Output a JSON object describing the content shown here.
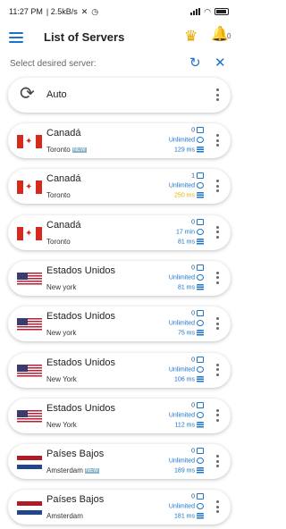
{
  "status": {
    "time": "11:27 PM",
    "speed": "2.5kB/s"
  },
  "appbar": {
    "title": "List of Servers",
    "notification_count": "0"
  },
  "select_label": "Select desired server:",
  "auto": {
    "label": "Auto"
  },
  "servers": [
    {
      "country": "Canadá",
      "city": "Toronto",
      "new": true,
      "flag": "ca",
      "users": "0",
      "time": "Unlimited",
      "ping": "129 ms",
      "ping_color": "blue"
    },
    {
      "country": "Canadá",
      "city": "Toronto",
      "new": false,
      "flag": "ca",
      "users": "1",
      "time": "Unlimited",
      "ping": "250 ms",
      "ping_color": "yellow"
    },
    {
      "country": "Canadá",
      "city": "Toronto",
      "new": false,
      "flag": "ca",
      "users": "0",
      "time": "17 min",
      "ping": "81 ms",
      "ping_color": "blue"
    },
    {
      "country": "Estados Unidos",
      "city": "New york",
      "new": false,
      "flag": "us",
      "users": "0",
      "time": "Unlimited",
      "ping": "81 ms",
      "ping_color": "blue"
    },
    {
      "country": "Estados Unidos",
      "city": "New york",
      "new": false,
      "flag": "us",
      "users": "0",
      "time": "Unlimited",
      "ping": "75 ms",
      "ping_color": "blue"
    },
    {
      "country": "Estados Unidos",
      "city": "New York",
      "new": false,
      "flag": "us",
      "users": "0",
      "time": "Unlimited",
      "ping": "106 ms",
      "ping_color": "blue"
    },
    {
      "country": "Estados Unidos",
      "city": "New York",
      "new": false,
      "flag": "us",
      "users": "0",
      "time": "Unlimited",
      "ping": "112 ms",
      "ping_color": "blue"
    },
    {
      "country": "Países Bajos",
      "city": "Amsterdam",
      "new": true,
      "flag": "nl",
      "users": "0",
      "time": "Unlimited",
      "ping": "189 ms",
      "ping_color": "blue"
    },
    {
      "country": "Países Bajos",
      "city": "Amsterdam",
      "new": false,
      "flag": "nl",
      "users": "0",
      "time": "Unlimited",
      "ping": "181 ms",
      "ping_color": "blue"
    }
  ],
  "new_badge_label": "NEW",
  "colors": {
    "accent": "#1a73c9",
    "crown": "#e6a800",
    "ping_warning": "#e0b800"
  }
}
